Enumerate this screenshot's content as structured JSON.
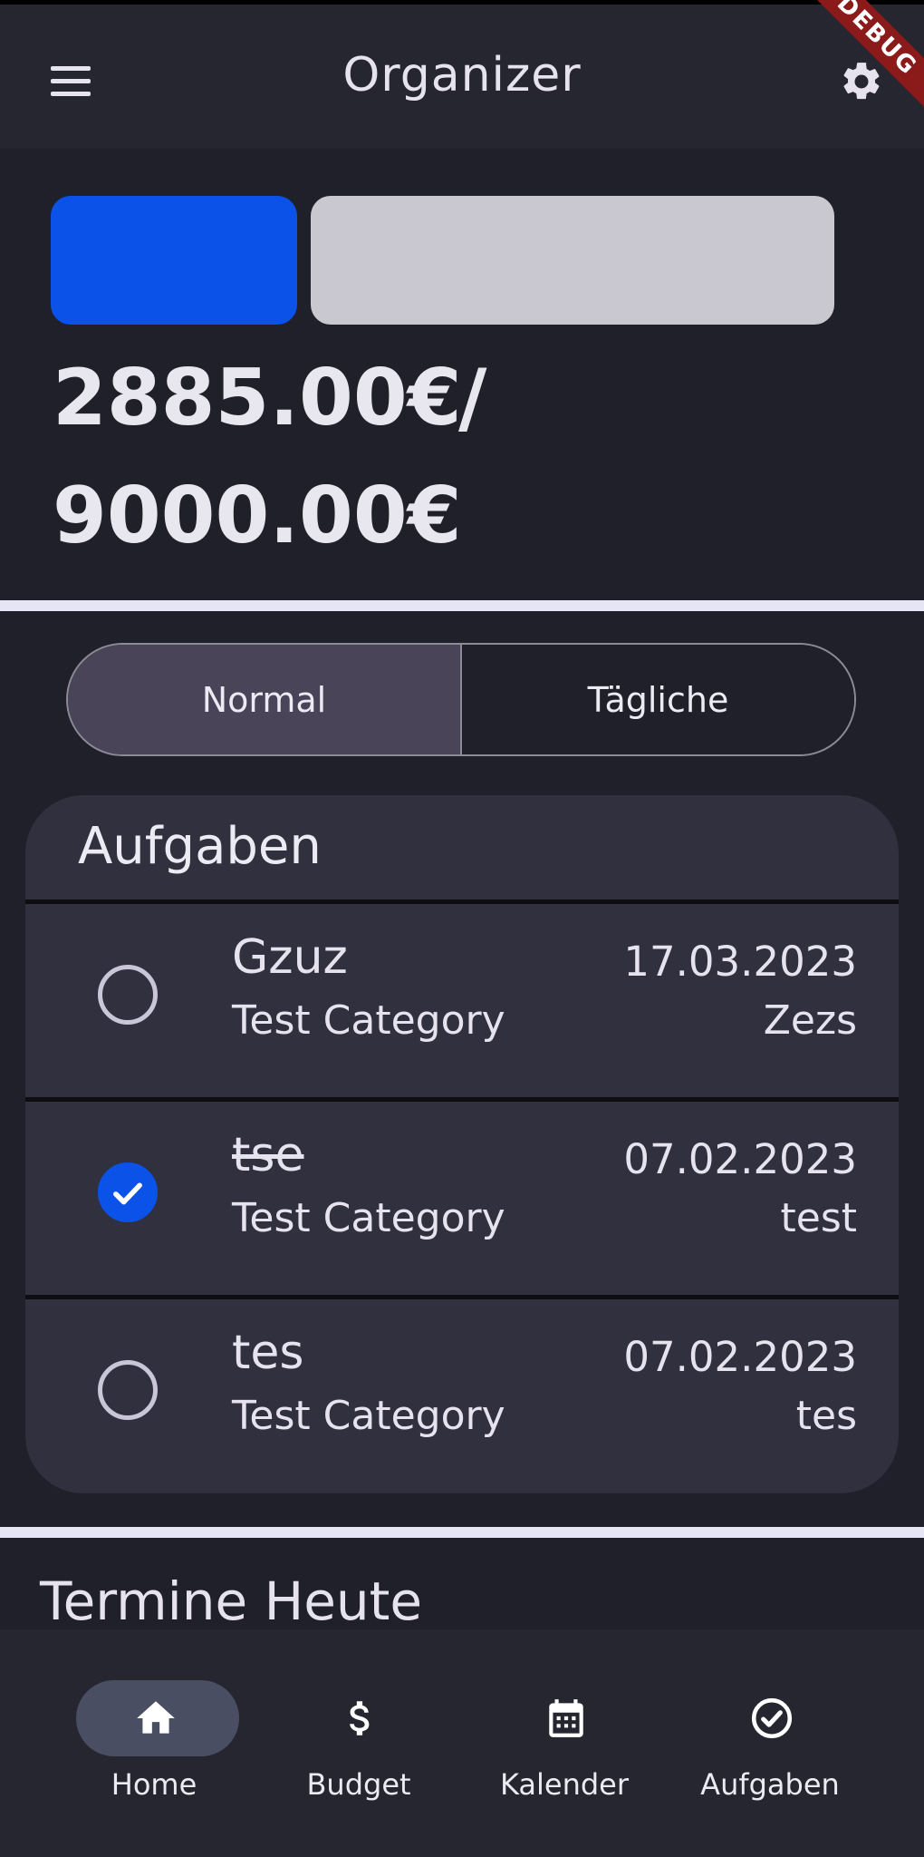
{
  "app": {
    "title": "Organizer",
    "debug_banner": "DEBUG"
  },
  "budget": {
    "spent": "2885.00€",
    "separator": "/",
    "total": "9000.00€",
    "spent_fraction": 0.32,
    "colors": {
      "spent": "#0B52E8",
      "remaining": "#C9C8D1"
    }
  },
  "segments": {
    "normal": "Normal",
    "daily": "Tägliche",
    "selected": "Normal"
  },
  "tasks": {
    "title": "Aufgaben",
    "items": [
      {
        "name": "Gzuz",
        "category": "Test Category",
        "date": "17.03.2023",
        "note": "Zezs",
        "done": false
      },
      {
        "name": "tse",
        "category": "Test Category",
        "date": "07.02.2023",
        "note": "test",
        "done": true
      },
      {
        "name": "tes",
        "category": "Test Category",
        "date": "07.02.2023",
        "note": "tes",
        "done": false
      }
    ]
  },
  "today": {
    "title": "Termine Heute"
  },
  "nav": {
    "items": [
      {
        "label": "Home",
        "icon": "home-icon",
        "active": true
      },
      {
        "label": "Budget",
        "icon": "dollar-icon",
        "active": false
      },
      {
        "label": "Kalender",
        "icon": "calendar-icon",
        "active": false
      },
      {
        "label": "Aufgaben",
        "icon": "check-circle-icon",
        "active": false
      }
    ]
  }
}
